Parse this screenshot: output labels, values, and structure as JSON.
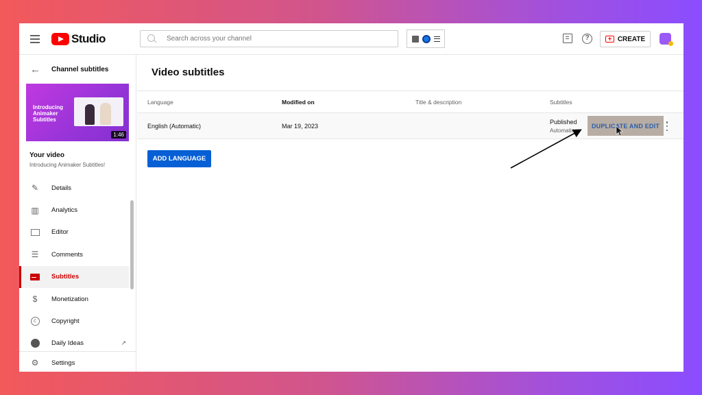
{
  "header": {
    "logo_text": "Studio",
    "search_placeholder": "Search across your channel",
    "create_label": "CREATE",
    "help_glyph": "?"
  },
  "sidebar": {
    "back_label": "Channel subtitles",
    "thumbnail_title": "Introducing Animaker Subtitles",
    "duration": "1:46",
    "your_video_label": "Your video",
    "video_name": "Introducing Animaker Subtitles!",
    "items": [
      {
        "label": "Details",
        "icon": "pencil-icon",
        "glyph": "✎"
      },
      {
        "label": "Analytics",
        "icon": "analytics-icon",
        "glyph": "▥"
      },
      {
        "label": "Editor",
        "icon": "editor-icon",
        "glyph": ""
      },
      {
        "label": "Comments",
        "icon": "comments-icon",
        "glyph": "☰"
      },
      {
        "label": "Subtitles",
        "icon": "subtitles-icon",
        "glyph": ""
      },
      {
        "label": "Monetization",
        "icon": "dollar-icon",
        "glyph": "$"
      },
      {
        "label": "Copyright",
        "icon": "copyright-icon",
        "glyph": "c"
      },
      {
        "label": "Daily Ideas",
        "icon": "ideas-icon",
        "glyph": ""
      }
    ],
    "settings_label": "Settings",
    "external_link_glyph": "↗"
  },
  "main": {
    "title": "Video subtitles",
    "columns": [
      "Language",
      "Modified on",
      "Title & description",
      "Subtitles"
    ],
    "row": {
      "language": "English (Automatic)",
      "modified": "Mar 19, 2023",
      "status": "Published",
      "status_sub": "Automatic",
      "action_label": "DUPLICATE AND EDIT"
    },
    "add_language_label": "ADD LANGUAGE"
  },
  "colors": {
    "accent_red": "#cc0000",
    "primary_blue": "#065fd4"
  }
}
